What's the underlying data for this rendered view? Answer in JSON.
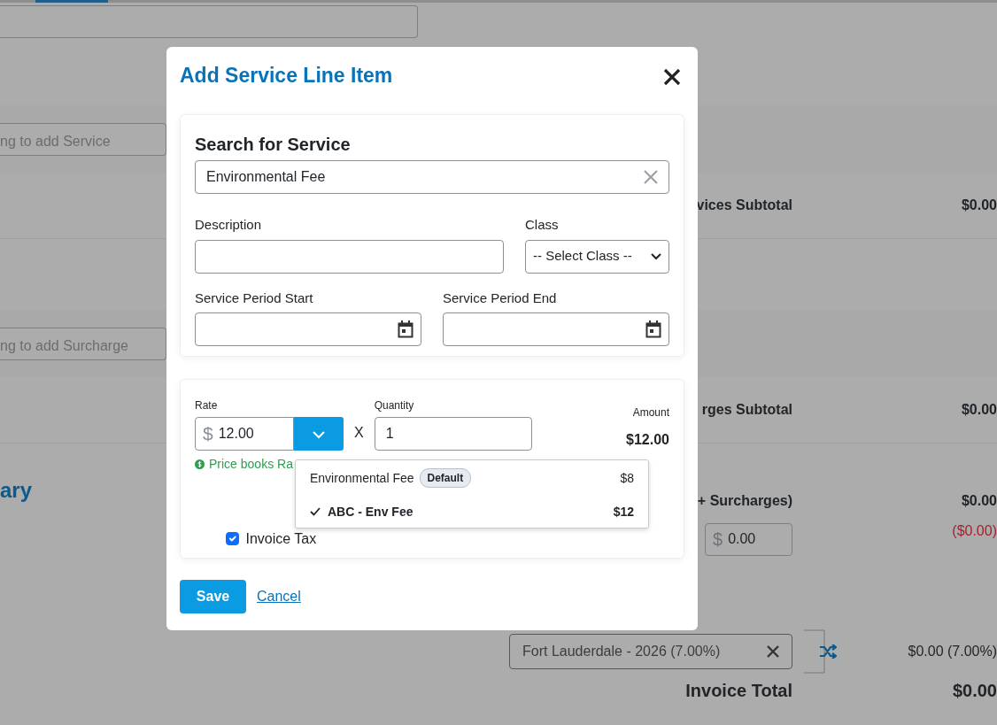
{
  "background": {
    "service_search": {
      "placeholder": "ng to add Service"
    },
    "services_subtotal": {
      "label": "vices Subtotal",
      "value": "$0.00"
    },
    "surcharge_search": {
      "placeholder": "ng to add Surcharge"
    },
    "surcharges_subtotal": {
      "label": "rges Subtotal",
      "value": "$0.00"
    },
    "summary_heading": "ary",
    "subtotal_with_surcharges": {
      "label": "+ Surcharges)",
      "value": "$0.00"
    },
    "discount": {
      "prefix": "$",
      "value": "0.00",
      "amount": "($0.00)"
    },
    "tax": {
      "value": "Fort Lauderdale - 2026 (7.00%)",
      "amount": "$0.00 (7.00%)"
    },
    "invoice_total": {
      "label": "Invoice Total",
      "value": "$0.00"
    }
  },
  "modal": {
    "title": "Add Service Line Item",
    "search": {
      "heading": "Search for Service",
      "value": "Environmental Fee"
    },
    "field_rows": [
      [
        {
          "label": "Description",
          "kind": "text"
        },
        {
          "label": "Class",
          "kind": "select",
          "value": "-- Select Class --"
        }
      ],
      [
        {
          "label": "Service Period Start",
          "kind": "date"
        },
        {
          "label": "Service Period End",
          "kind": "date"
        }
      ]
    ],
    "rate": {
      "label": "Rate",
      "prefix": "$",
      "value": "12.00"
    },
    "multiply_sign": "X",
    "quantity": {
      "label": "Quantity",
      "value": "1"
    },
    "amount": {
      "label": "Amount",
      "value": "$12.00"
    },
    "rate_note": "Price books Ra",
    "rate_menu": {
      "expanded": true,
      "options": [
        {
          "name": "Environmental Fee",
          "badge": "Default",
          "price": "$8",
          "selected": false
        },
        {
          "name": "ABC - Env Fee",
          "price": "$12",
          "selected": true
        }
      ]
    },
    "invoice_tax": {
      "label": "Invoice Tax",
      "checked": true
    },
    "save": "Save",
    "cancel": "Cancel"
  }
}
